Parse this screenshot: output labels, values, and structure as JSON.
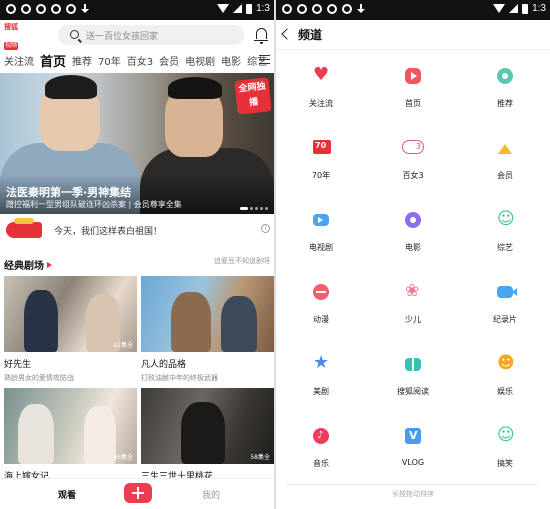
{
  "status": {
    "time": "1:3"
  },
  "left": {
    "logo": {
      "line1": "搜狐",
      "line2": "视频"
    },
    "search_placeholder": "送一百位女孩回家",
    "tabs": [
      "关注流",
      "首页",
      "推荐",
      "70年",
      "百女3",
      "会员",
      "电视剧",
      "电影",
      "综艺"
    ],
    "active_tab": "首页",
    "banner": {
      "title": "法医秦明第一季·男神集结",
      "subtitle": "蹭控福利一型男组队破连环凶杀案 | 会员尊享全集",
      "badge": "全网独播"
    },
    "notice": {
      "text": "今天，我们这样表白祖国！"
    },
    "section": {
      "title": "经典剧场",
      "more": "追爱豆不知道剧呀"
    },
    "cards": [
      {
        "title": "好先生",
        "subtitle": "熟龄男女的爱情攻防战",
        "count": "42集全"
      },
      {
        "title": "凡人的品格",
        "subtitle": "打败油腻中年的终极武器",
        "count": ""
      },
      {
        "title": "海上嫁女记",
        "subtitle": "",
        "count": "46集全"
      },
      {
        "title": "三生三世十里桃花",
        "subtitle": "",
        "count": "58集全"
      }
    ],
    "bottom": {
      "watch": "观看",
      "mine": "我的"
    }
  },
  "right": {
    "title": "频道",
    "channels": [
      {
        "label": "关注流",
        "icon": "heart-icon"
      },
      {
        "label": "首页",
        "icon": "play-icon"
      },
      {
        "label": "推荐",
        "icon": "award-icon"
      },
      {
        "label": "70年",
        "icon": "seventy-icon"
      },
      {
        "label": "百女3",
        "icon": "bainv-icon"
      },
      {
        "label": "会员",
        "icon": "crown-icon"
      },
      {
        "label": "电视剧",
        "icon": "tv-icon"
      },
      {
        "label": "电影",
        "icon": "film-icon"
      },
      {
        "label": "综艺",
        "icon": "variety-icon"
      },
      {
        "label": "动漫",
        "icon": "anime-icon"
      },
      {
        "label": "少儿",
        "icon": "kids-icon"
      },
      {
        "label": "纪录片",
        "icon": "documentary-icon"
      },
      {
        "label": "美剧",
        "icon": "star-icon"
      },
      {
        "label": "搜狐阅读",
        "icon": "book-icon"
      },
      {
        "label": "娱乐",
        "icon": "entertainment-icon"
      },
      {
        "label": "音乐",
        "icon": "music-icon"
      },
      {
        "label": "VLOG",
        "icon": "vlog-icon"
      },
      {
        "label": "搞笑",
        "icon": "funny-icon"
      }
    ],
    "footer": "长按拖动排序"
  }
}
